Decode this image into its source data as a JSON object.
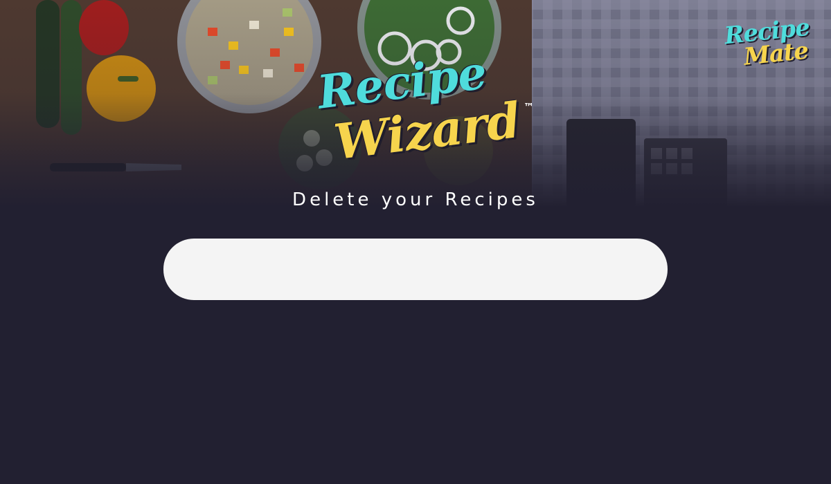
{
  "hero": {
    "brand_logo": {
      "line1": "Recipe",
      "line2": "Mate"
    },
    "main_logo": {
      "line1": "Recipe",
      "line2": "Wizard",
      "trademark": "™"
    },
    "subtitle": "Delete your Recipes"
  },
  "recipe_panel": {
    "items": []
  },
  "colors": {
    "background": "#222031",
    "logo_cyan": "#4fdcdc",
    "logo_yellow": "#f6d44d",
    "panel": "#f4f4f4",
    "subtitle_text": "#ffffff"
  }
}
